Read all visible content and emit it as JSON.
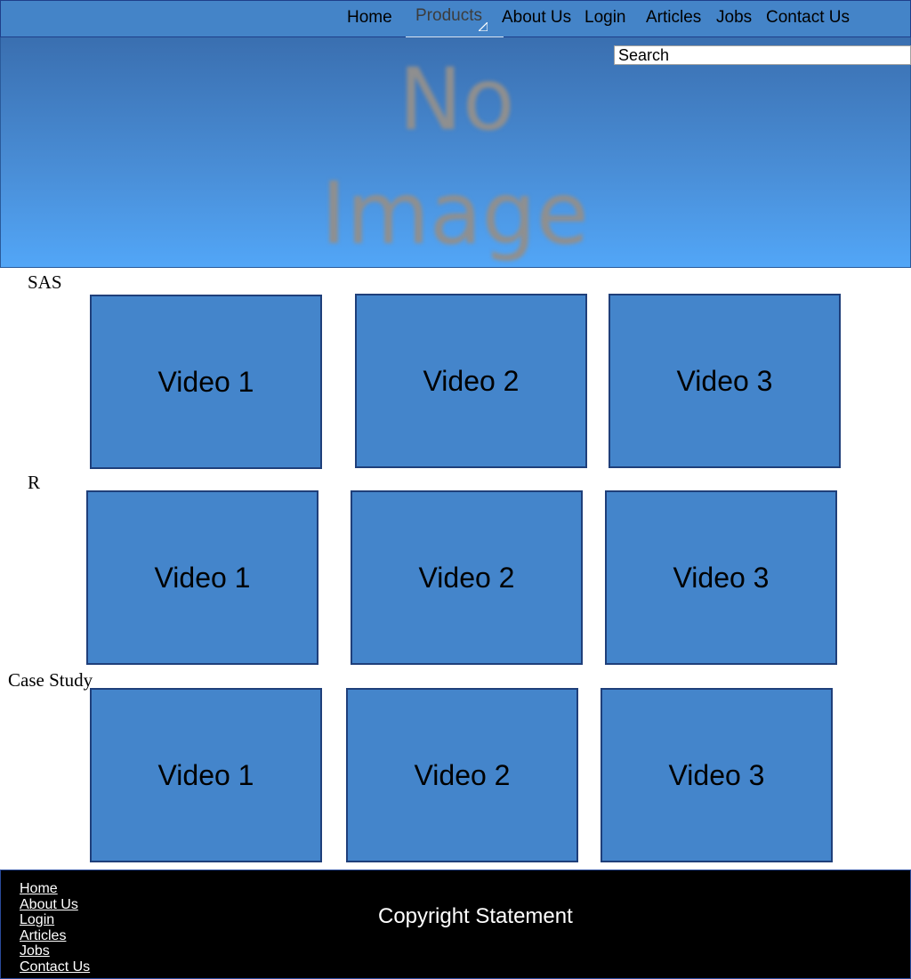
{
  "nav": {
    "home": "Home",
    "products": "Products",
    "about": "About Us",
    "login": "Login",
    "articles": "Articles",
    "jobs": "Jobs",
    "contact": "Contact Us"
  },
  "hero": {
    "placeholder_line1": "No",
    "placeholder_line2": "Image",
    "search_value": "Search"
  },
  "sections": [
    {
      "title": "SAS",
      "videos": [
        "Video 1",
        "Video 2",
        "Video 3"
      ]
    },
    {
      "title": "R",
      "videos": [
        "Video 1",
        "Video 2",
        "Video 3"
      ]
    },
    {
      "title": "Case Study",
      "videos": [
        "Video 1",
        "Video 2",
        "Video 3"
      ]
    }
  ],
  "footer": {
    "links": [
      "Home",
      "About Us",
      "Login",
      "Articles",
      "Jobs",
      "Contact Us"
    ],
    "copyright": "Copyright Statement"
  },
  "colors": {
    "nav_bg": "#4484c8",
    "video_tile": "#4485cb",
    "footer_bg": "#000000"
  }
}
